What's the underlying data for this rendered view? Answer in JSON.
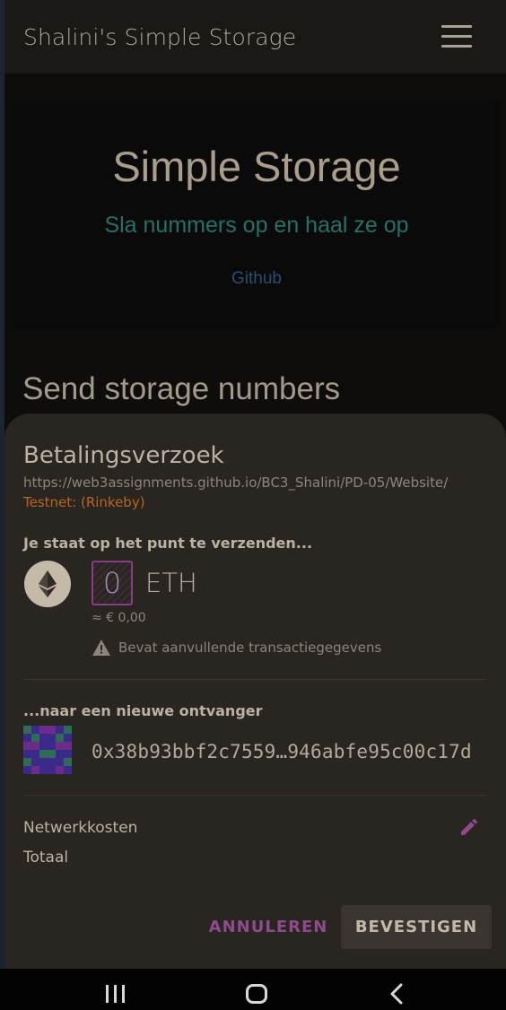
{
  "app_bar": {
    "title": "Shalini's Simple Storage",
    "menu_icon": "hamburger-menu-icon"
  },
  "hero": {
    "title": "Simple Storage",
    "subtitle": "Sla nummers op en haal ze op",
    "link": "Github"
  },
  "section": {
    "heading": "Send storage numbers"
  },
  "payment_request": {
    "title": "Betalingsverzoek",
    "url": "https://web3assignments.github.io/BC3_Shalini/PD-05/Website/",
    "network": "Testnet: (Rinkeby)",
    "sending_label": "Je staat op het punt te verzenden...",
    "amount": "0",
    "currency": "ETH",
    "fiat_value": "≈ € 0,00",
    "warning": "Bevat aanvullende transactiegegevens",
    "recipient_label": "...naar een nieuwe ontvanger",
    "recipient_address": "0x38b93bbf2c7559…946abfe95c00c17d",
    "network_fees_label": "Netwerkkosten",
    "total_label": "Totaal",
    "cancel_label": "ANNULEREN",
    "confirm_label": "BEVESTIGEN"
  },
  "colors": {
    "accent_purple": "#8e4a8d",
    "network_orange": "#b8661f",
    "subtitle_teal": "#26706a",
    "link_blue": "#2a4e70"
  },
  "icons": {
    "eth": "ethereum-logo-icon",
    "warning": "warning-triangle-icon",
    "edit": "pencil-edit-icon",
    "identicon": "recipient-identicon",
    "nav_recents": "recents-icon",
    "nav_home": "home-icon",
    "nav_back": "back-icon"
  }
}
